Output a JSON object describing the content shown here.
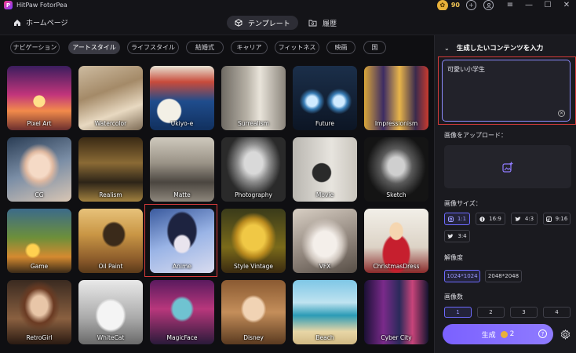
{
  "window": {
    "app_title": "HitPaw FotorPea",
    "coin_count": "90",
    "minimize": "—",
    "maximize": "☐",
    "close": "✕"
  },
  "nav": {
    "home": "ホームページ",
    "tabs": [
      {
        "label": "テンプレート",
        "active": true
      },
      {
        "label": "履歴",
        "active": false
      }
    ]
  },
  "categories": [
    {
      "label": "ナビゲーション",
      "active": false
    },
    {
      "label": "アートスタイル",
      "active": true
    },
    {
      "label": "ライフスタイル",
      "active": false
    },
    {
      "label": "結婚式",
      "active": false
    },
    {
      "label": "キャリア",
      "active": false
    },
    {
      "label": "フィットネス",
      "active": false
    },
    {
      "label": "映画",
      "active": false
    },
    {
      "label": "国",
      "active": false
    }
  ],
  "styles": [
    {
      "label": "Pixel Art"
    },
    {
      "label": "Watercolor"
    },
    {
      "label": "Ukiyo-e"
    },
    {
      "label": "Surrealism"
    },
    {
      "label": "Future"
    },
    {
      "label": "Impressionism"
    },
    {
      "label": "CG"
    },
    {
      "label": "Realism"
    },
    {
      "label": "Matte"
    },
    {
      "label": "Photography"
    },
    {
      "label": "Movie"
    },
    {
      "label": "Sketch"
    },
    {
      "label": "Game"
    },
    {
      "label": "Oil Paint"
    },
    {
      "label": "Anime",
      "selected": true
    },
    {
      "label": "Style Vintage"
    },
    {
      "label": "VFX"
    },
    {
      "label": "ChristmasDress"
    },
    {
      "label": "RetroGirl"
    },
    {
      "label": "WhiteCat"
    },
    {
      "label": "MagicFace"
    },
    {
      "label": "Disney"
    },
    {
      "label": "Beach"
    },
    {
      "label": "Cyber City"
    }
  ],
  "panel": {
    "header": "生成したいコンテンツを入力",
    "prompt_value": "可愛い小学生",
    "upload_label": "画像をアップロード：",
    "size_label": "画像サイズ：",
    "sizes": [
      {
        "label": "1:1",
        "icon": "instagram-icon",
        "active": true
      },
      {
        "label": "16:9",
        "icon": "pinterest-icon",
        "active": false
      },
      {
        "label": "4:3",
        "icon": "twitter-icon",
        "active": false
      },
      {
        "label": "9:16",
        "icon": "tiktok-icon",
        "active": false
      },
      {
        "label": "3:4",
        "icon": "twitter-icon",
        "active": false
      }
    ],
    "resolution_label": "解像度",
    "resolutions": [
      {
        "label": "1024*1024",
        "active": true
      },
      {
        "label": "2048*2048",
        "active": false
      }
    ],
    "count_label": "画像数",
    "counts": [
      {
        "label": "1",
        "active": true
      },
      {
        "label": "2",
        "active": false
      },
      {
        "label": "3",
        "active": false
      },
      {
        "label": "4",
        "active": false
      }
    ],
    "generate_label": "生成",
    "generate_cost": "2",
    "help": "?"
  },
  "colors": {
    "accent": "#7b61ff",
    "highlight": "#d63b3b",
    "coin": "#e8b13a"
  }
}
